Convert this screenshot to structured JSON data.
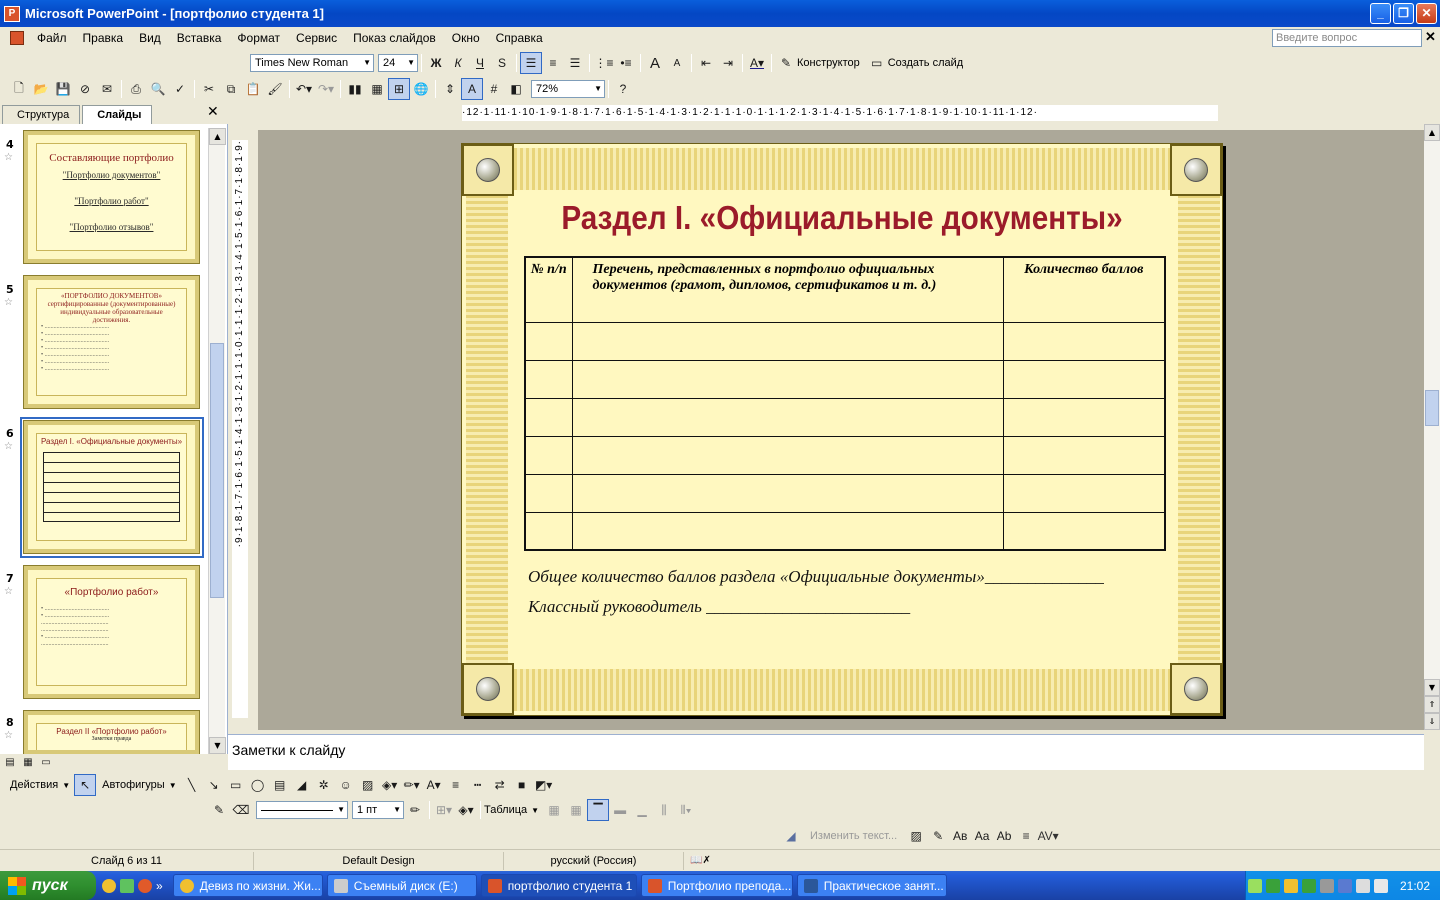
{
  "window": {
    "title": "Microsoft PowerPoint - [портфолио студента 1]"
  },
  "menu": {
    "items": [
      "Файл",
      "Правка",
      "Вид",
      "Вставка",
      "Формат",
      "Сервис",
      "Показ слайдов",
      "Окно",
      "Справка"
    ],
    "help_placeholder": "Введите вопрос"
  },
  "format_toolbar": {
    "font": "Times New Roman",
    "size": "24",
    "bold": "Ж",
    "italic": "К",
    "underline": "Ч",
    "shadow": "S",
    "design": "Конструктор",
    "new_slide": "Создать слайд"
  },
  "standard_toolbar": {
    "zoom": "72%"
  },
  "left_pane": {
    "tabs": [
      "Структура",
      "Слайды"
    ],
    "thumbs": [
      {
        "num": "4",
        "title": "Составляющие портфолио",
        "lines": [
          "\"Портфолио документов\"",
          "\"Портфолио работ\"",
          "\"Портфолио отзывов\""
        ]
      },
      {
        "num": "5",
        "title": "«ПОРТФОЛИО ДОКУМЕНТОВ» сертифицированные (документированные) индивидуальные образовательные достижения."
      },
      {
        "num": "6",
        "title": "Раздел I. «Официальные документы»"
      },
      {
        "num": "7",
        "title": "«Портфолио работ»"
      },
      {
        "num": "8",
        "title": "Раздел II «Портфолио работ»",
        "sub": "Заметки правда"
      }
    ]
  },
  "ruler": {
    "h": "·12·1·11·1·10·1·9·1·8·1·7·1·6·1·5·1·4·1·3·1·2·1·1·1·0·1·1·1·2·1·3·1·4·1·5·1·6·1·7·1·8·1·9·1·10·1·11·1·12·"
  },
  "slide": {
    "title": "Раздел I. «Официальные документы»",
    "table": {
      "headers": [
        "№ п/п",
        "Перечень, представленных в портфолио официальных документов (грамот, дипломов, сертификатов и т. д.)",
        "Количество баллов"
      ],
      "empty_rows": 6
    },
    "line1": "Общее количество баллов раздела «Официальные документы»______________",
    "line2": "Классный руководитель ________________________"
  },
  "notes": {
    "placeholder": "Заметки к слайду"
  },
  "drawing_toolbar": {
    "actions": "Действия",
    "autoshapes": "Автофигуры"
  },
  "table_toolbar": {
    "line_width": "1 пт",
    "table": "Таблица"
  },
  "wordart_toolbar": {
    "edit_text": "Изменить текст..."
  },
  "status": {
    "slide": "Слайд 6 из 11",
    "design": "Default Design",
    "language": "русский (Россия)"
  },
  "taskbar": {
    "start": "пуск",
    "items": [
      "Девиз по жизни. Жи...",
      "Съемный диск (E:)",
      "портфолио студента 1",
      "Портфолио препода...",
      "Практическое занят..."
    ],
    "clock": "21:02"
  },
  "colors": {
    "title_red": "#9b1b2a",
    "slide_bg": "#fff8c0",
    "xp_blue": "#0a5fdc"
  }
}
